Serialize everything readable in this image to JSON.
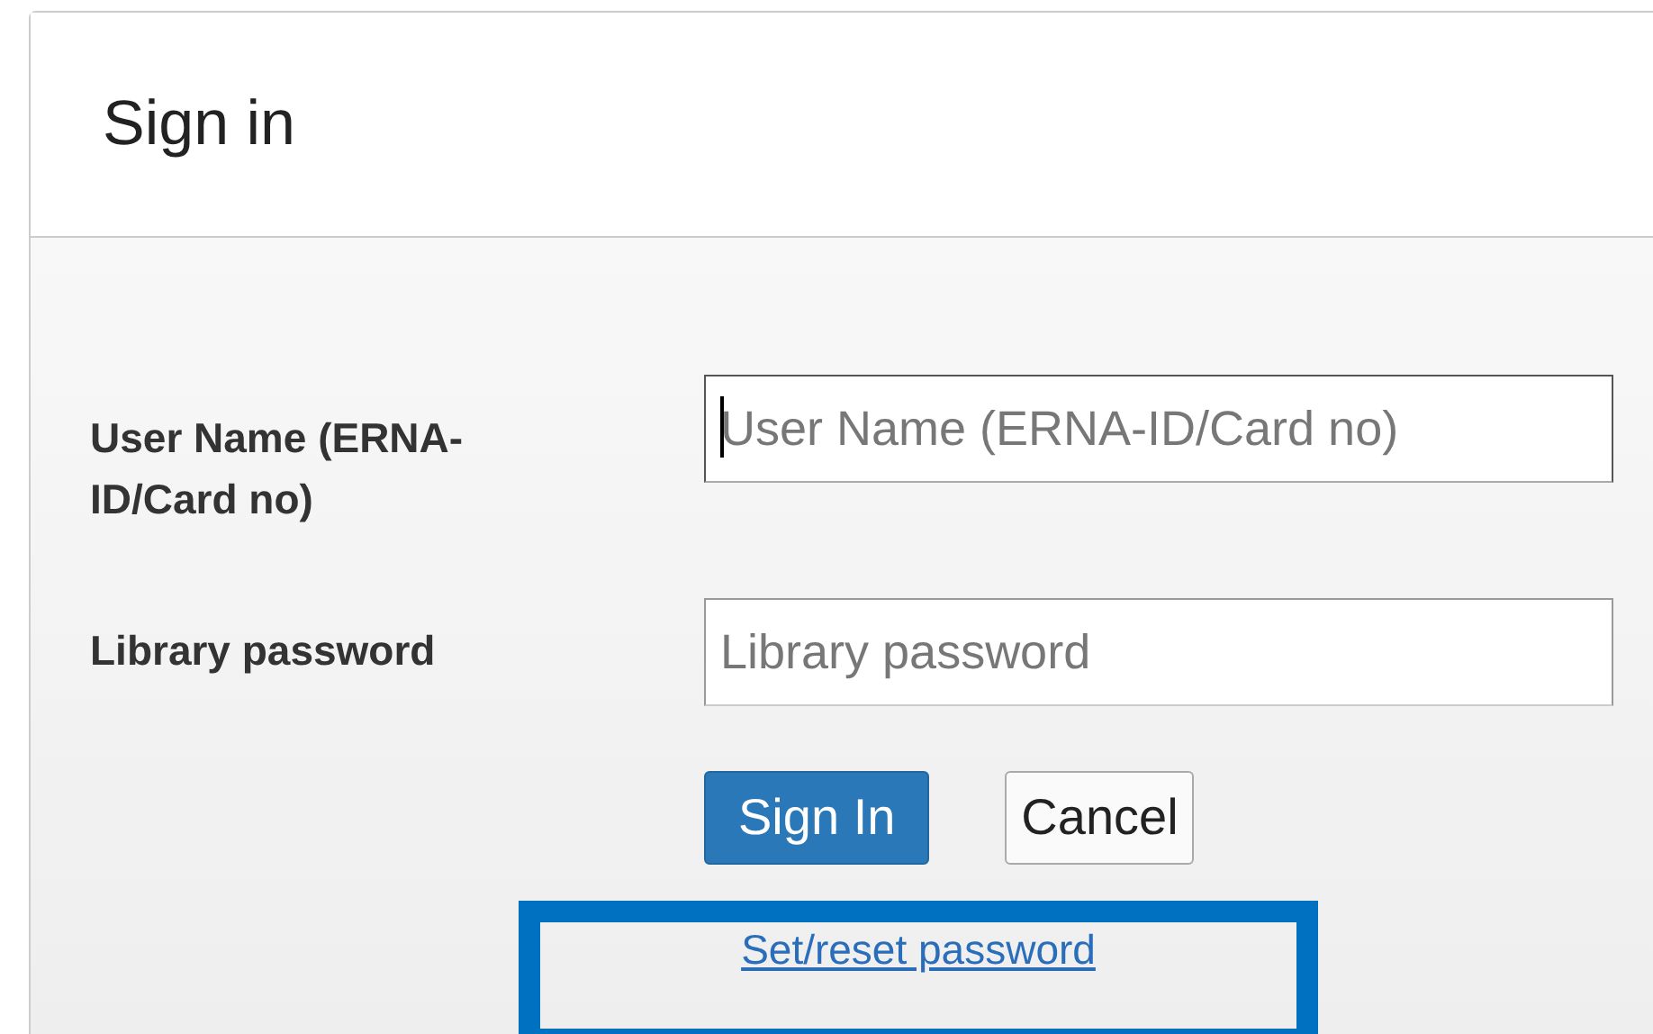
{
  "dialog": {
    "title": "Sign in"
  },
  "fields": [
    {
      "label": "User Name (ERNA-ID/Card no)",
      "placeholder": "User Name (ERNA-ID/Card no)",
      "focused": true
    },
    {
      "label": "Library password",
      "placeholder": "Library password",
      "focused": false
    }
  ],
  "buttons": [
    {
      "label": "Sign In",
      "kind": "primary"
    },
    {
      "label": "Cancel",
      "kind": "secondary"
    }
  ],
  "link": {
    "label": "Set/reset password",
    "highlighted": true
  }
}
